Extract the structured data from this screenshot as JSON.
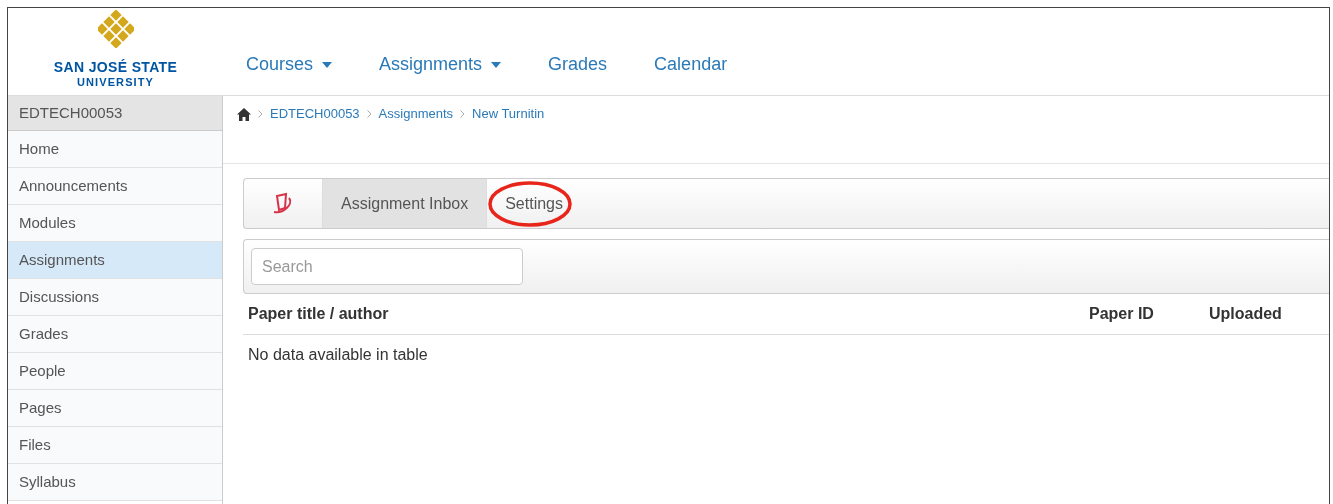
{
  "header": {
    "logo": {
      "line_1": "SAN JOSÉ STATE",
      "line_2": "UNIVERSITY"
    },
    "nav": [
      {
        "label": "Courses",
        "dropdown": true
      },
      {
        "label": "Assignments",
        "dropdown": true
      },
      {
        "label": "Grades",
        "dropdown": false
      },
      {
        "label": "Calendar",
        "dropdown": false
      }
    ]
  },
  "sidebar": {
    "title": "EDTECH00053",
    "items": [
      {
        "label": "Home",
        "selected": false
      },
      {
        "label": "Announcements",
        "selected": false
      },
      {
        "label": "Modules",
        "selected": false
      },
      {
        "label": "Assignments",
        "selected": true
      },
      {
        "label": "Discussions",
        "selected": false
      },
      {
        "label": "Grades",
        "selected": false
      },
      {
        "label": "People",
        "selected": false
      },
      {
        "label": "Pages",
        "selected": false
      },
      {
        "label": "Files",
        "selected": false
      },
      {
        "label": "Syllabus",
        "selected": false
      }
    ]
  },
  "breadcrumb": [
    "EDTECH00053",
    "Assignments",
    "New Turnitin"
  ],
  "tabs": [
    {
      "kind": "icon",
      "selected": false,
      "highlighted": false
    },
    {
      "kind": "text",
      "label": "Assignment Inbox",
      "selected": true,
      "highlighted": false
    },
    {
      "kind": "text",
      "label": "Settings",
      "selected": false,
      "highlighted": true
    }
  ],
  "search": {
    "placeholder": "Search"
  },
  "table": {
    "columns": [
      "Paper title / author",
      "Paper ID",
      "Uploaded"
    ],
    "empty_message": "No data available in table"
  }
}
